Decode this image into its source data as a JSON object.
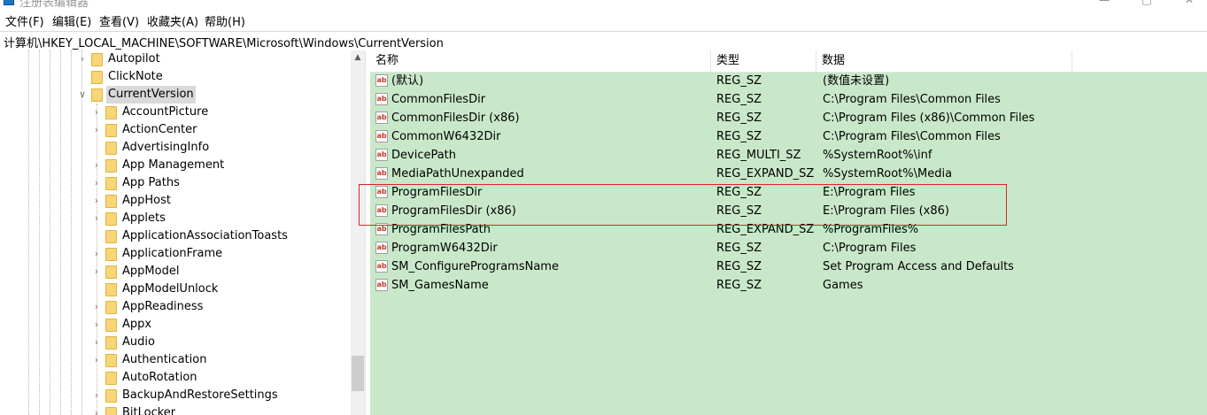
{
  "window": {
    "title": "注册表编辑器"
  },
  "menu": [
    "文件(F)",
    "编辑(E)",
    "查看(V)",
    "收藏夹(A)",
    "帮助(H)"
  ],
  "address": "计算机\\HKEY_LOCAL_MACHINE\\SOFTWARE\\Microsoft\\Windows\\CurrentVersion",
  "tree": [
    {
      "label": "Autopilot",
      "level": 1,
      "expandable": true,
      "expanded": false,
      "selected": false
    },
    {
      "label": "ClickNote",
      "level": 1,
      "expandable": false,
      "expanded": false,
      "selected": false
    },
    {
      "label": "CurrentVersion",
      "level": 1,
      "expandable": true,
      "expanded": true,
      "selected": true
    },
    {
      "label": "AccountPicture",
      "level": 2,
      "expandable": true,
      "expanded": false,
      "selected": false
    },
    {
      "label": "ActionCenter",
      "level": 2,
      "expandable": true,
      "expanded": false,
      "selected": false
    },
    {
      "label": "AdvertisingInfo",
      "level": 2,
      "expandable": false,
      "expanded": false,
      "selected": false
    },
    {
      "label": "App Management",
      "level": 2,
      "expandable": true,
      "expanded": false,
      "selected": false
    },
    {
      "label": "App Paths",
      "level": 2,
      "expandable": true,
      "expanded": false,
      "selected": false
    },
    {
      "label": "AppHost",
      "level": 2,
      "expandable": true,
      "expanded": false,
      "selected": false
    },
    {
      "label": "Applets",
      "level": 2,
      "expandable": true,
      "expanded": false,
      "selected": false
    },
    {
      "label": "ApplicationAssociationToasts",
      "level": 2,
      "expandable": false,
      "expanded": false,
      "selected": false
    },
    {
      "label": "ApplicationFrame",
      "level": 2,
      "expandable": true,
      "expanded": false,
      "selected": false
    },
    {
      "label": "AppModel",
      "level": 2,
      "expandable": true,
      "expanded": false,
      "selected": false
    },
    {
      "label": "AppModelUnlock",
      "level": 2,
      "expandable": false,
      "expanded": false,
      "selected": false
    },
    {
      "label": "AppReadiness",
      "level": 2,
      "expandable": true,
      "expanded": false,
      "selected": false
    },
    {
      "label": "Appx",
      "level": 2,
      "expandable": true,
      "expanded": false,
      "selected": false
    },
    {
      "label": "Audio",
      "level": 2,
      "expandable": true,
      "expanded": false,
      "selected": false
    },
    {
      "label": "Authentication",
      "level": 2,
      "expandable": true,
      "expanded": false,
      "selected": false
    },
    {
      "label": "AutoRotation",
      "level": 2,
      "expandable": false,
      "expanded": false,
      "selected": false
    },
    {
      "label": "BackupAndRestoreSettings",
      "level": 2,
      "expandable": true,
      "expanded": false,
      "selected": false
    },
    {
      "label": "BitLocker",
      "level": 2,
      "expandable": true,
      "expanded": false,
      "selected": false
    }
  ],
  "columns": [
    "名称",
    "类型",
    "数据"
  ],
  "values": [
    {
      "name": "(默认)",
      "type": "REG_SZ",
      "data": "(数值未设置)"
    },
    {
      "name": "CommonFilesDir",
      "type": "REG_SZ",
      "data": "C:\\Program Files\\Common Files"
    },
    {
      "name": "CommonFilesDir (x86)",
      "type": "REG_SZ",
      "data": "C:\\Program Files (x86)\\Common Files"
    },
    {
      "name": "CommonW6432Dir",
      "type": "REG_SZ",
      "data": "C:\\Program Files\\Common Files"
    },
    {
      "name": "DevicePath",
      "type": "REG_MULTI_SZ",
      "data": "%SystemRoot%\\inf"
    },
    {
      "name": "MediaPathUnexpanded",
      "type": "REG_EXPAND_SZ",
      "data": "%SystemRoot%\\Media"
    },
    {
      "name": "ProgramFilesDir",
      "type": "REG_SZ",
      "data": "E:\\Program Files"
    },
    {
      "name": "ProgramFilesDir (x86)",
      "type": "REG_SZ",
      "data": "E:\\Program Files (x86)"
    },
    {
      "name": "ProgramFilesPath",
      "type": "REG_EXPAND_SZ",
      "data": "%ProgramFiles%"
    },
    {
      "name": "ProgramW6432Dir",
      "type": "REG_SZ",
      "data": "C:\\Program Files"
    },
    {
      "name": "SM_ConfigureProgramsName",
      "type": "REG_SZ",
      "data": "Set Program Access and Defaults"
    },
    {
      "name": "SM_GamesName",
      "type": "REG_SZ",
      "data": "Games"
    }
  ],
  "icons": {
    "value_icon": "string-value-icon",
    "folder_icon": "folder-icon"
  },
  "colors": {
    "list_background": "#c9e8c9",
    "highlight_border": "#d9262a",
    "folder": "#f7d677"
  }
}
